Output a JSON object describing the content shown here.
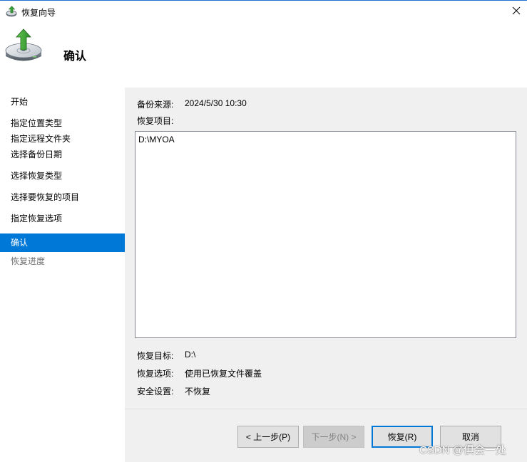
{
  "window": {
    "title": "恢复向导",
    "icon": "recovery-wizard-icon"
  },
  "header": {
    "title": "确认",
    "icon": "disk-restore-icon"
  },
  "sidebar": {
    "items": [
      {
        "label": "开始"
      },
      {
        "label": "指定位置类型"
      },
      {
        "label": "指定远程文件夹"
      },
      {
        "label": "选择备份日期"
      },
      {
        "label": "选择恢复类型"
      },
      {
        "label": "选择要恢复的项目"
      },
      {
        "label": "指定恢复选项"
      },
      {
        "label": "确认",
        "active": true
      },
      {
        "label": "恢复进度",
        "disabled": true
      }
    ]
  },
  "details": {
    "backup_source_label": "备份来源:",
    "backup_source_value": "2024/5/30 10:30",
    "recovery_items_label": "恢复项目:",
    "recovery_items": [
      "D:\\MYOA"
    ],
    "recovery_target_label": "恢复目标:",
    "recovery_target_value": "D:\\",
    "recovery_options_label": "恢复选项:",
    "recovery_options_value": "使用已恢复文件覆盖",
    "security_settings_label": "安全设置:",
    "security_settings_value": "不恢复"
  },
  "buttons": {
    "back": "< 上一步(P)",
    "next": "下一步(N) >",
    "recover": "恢复(R)",
    "cancel": "取消"
  },
  "watermark": "CSDN @俱会一处",
  "colors": {
    "accent": "#0078d7",
    "content_bg": "#f0f0f0"
  }
}
